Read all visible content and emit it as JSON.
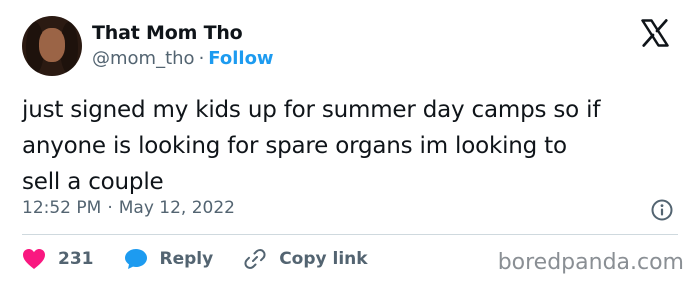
{
  "author": {
    "display_name": "That Mom Tho",
    "handle": "@mom_tho",
    "separator": "·",
    "follow_label": "Follow"
  },
  "tweet": {
    "text_lines": [
      "just signed my kids up for summer day camps so if",
      "anyone is looking for spare organs im looking to",
      "sell a couple"
    ],
    "time": "12:52 PM",
    "separator": "·",
    "date": "May 12, 2022"
  },
  "actions": {
    "like_count": "231",
    "reply_label": "Reply",
    "copy_link_label": "Copy link"
  },
  "watermark": "boredpanda.com",
  "colors": {
    "accent": "#1d9bf0",
    "heart": "#f91880",
    "reply_icon": "#1d9bf0",
    "muted": "#536471"
  },
  "icons": [
    "x-logo-icon",
    "info-icon",
    "heart-icon",
    "reply-bubble-icon",
    "link-icon"
  ]
}
